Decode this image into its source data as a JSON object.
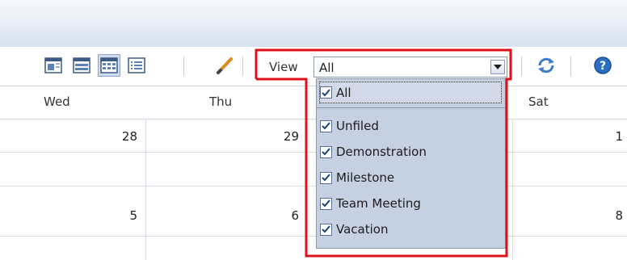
{
  "toolbar": {
    "view_label": "View",
    "view_value": "All",
    "buttons": [
      "day-view-icon",
      "week-view-icon",
      "month-view-icon",
      "list-view-icon",
      "pencil-icon",
      "refresh-icon",
      "help-icon"
    ]
  },
  "calendar": {
    "day_headers": [
      "Wed",
      "Thu",
      "Sat"
    ],
    "week1": [
      "28",
      "29",
      "1"
    ],
    "week2": [
      "5",
      "6",
      "8"
    ]
  },
  "dropdown": {
    "items": [
      {
        "label": "All",
        "checked": true
      },
      {
        "label": "Unfiled",
        "checked": true
      },
      {
        "label": "Demonstration",
        "checked": true
      },
      {
        "label": "Milestone",
        "checked": true
      },
      {
        "label": "Team Meeting",
        "checked": true
      },
      {
        "label": "Vacation",
        "checked": true
      }
    ]
  },
  "colors": {
    "highlight": "#e0101a",
    "dropdown_bg": "#c6d0e3",
    "selected_btn": "#cfdcef"
  }
}
